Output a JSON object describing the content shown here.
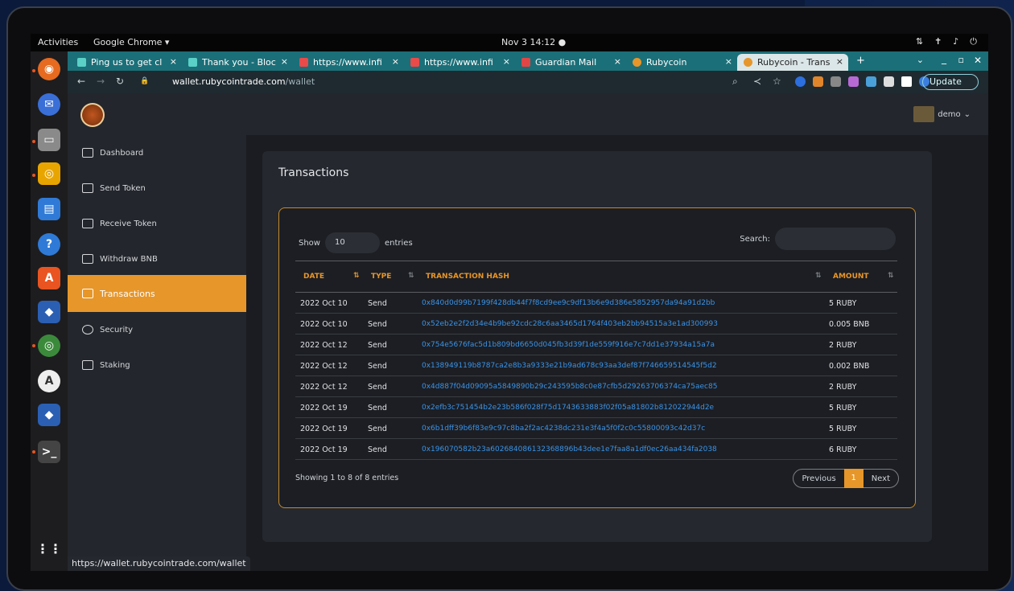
{
  "topbar": {
    "activities": "Activities",
    "app_name": "Google Chrome ▾",
    "clock": "Nov 3  14:12  ●"
  },
  "tabs": [
    {
      "label": "Ping us to get cl",
      "color": "#5ad0c6"
    },
    {
      "label": "Thank you - Bloc",
      "color": "#5ad0c6"
    },
    {
      "label": "https://www.infi",
      "color": "#e94a4a"
    },
    {
      "label": "https://www.infi",
      "color": "#e94a4a"
    },
    {
      "label": "Guardian Mail",
      "color": "#e04646"
    },
    {
      "label": "Rubycoin",
      "color": "#e7962a"
    },
    {
      "label": "Rubycoin - Trans",
      "color": "#e7962a"
    }
  ],
  "address": {
    "host": "wallet.rubycointrade.com",
    "path": "/wallet",
    "update_label": "Update"
  },
  "user": {
    "name": "demo"
  },
  "sidebar": {
    "items": [
      {
        "label": "Dashboard"
      },
      {
        "label": "Send Token"
      },
      {
        "label": "Receive Token"
      },
      {
        "label": "Withdraw BNB"
      },
      {
        "label": "Transactions"
      },
      {
        "label": "Security"
      },
      {
        "label": "Staking"
      }
    ]
  },
  "page": {
    "title": "Transactions",
    "show_label": "Show",
    "show_value": "10",
    "entries_label": "entries",
    "search_label": "Search:",
    "columns": [
      "DATE",
      "TYPE",
      "TRANSACTION HASH",
      "AMOUNT"
    ],
    "rows": [
      {
        "date": "2022 Oct 10",
        "type": "Send",
        "hash": "0x840d0d99b7199f428db44f7f8cd9ee9c9df13b6e9d386e5852957da94a91d2bb",
        "amount": "5 RUBY"
      },
      {
        "date": "2022 Oct 10",
        "type": "Send",
        "hash": "0x52eb2e2f2d34e4b9be92cdc28c6aa3465d1764f403eb2bb94515a3e1ad300993",
        "amount": "0.005 BNB"
      },
      {
        "date": "2022 Oct 12",
        "type": "Send",
        "hash": "0x754e5676fac5d1b809bd6650d045fb3d39f1de559f916e7c7dd1e37934a15a7a",
        "amount": "2 RUBY"
      },
      {
        "date": "2022 Oct 12",
        "type": "Send",
        "hash": "0x138949119b8787ca2e8b3a9333e21b9ad678c93aa3def87f746659514545f5d2",
        "amount": "0.002 BNB"
      },
      {
        "date": "2022 Oct 12",
        "type": "Send",
        "hash": "0x4d887f04d09095a5849890b29c243595b8c0e87cfb5d29263706374ca75aec85",
        "amount": "2 RUBY"
      },
      {
        "date": "2022 Oct 19",
        "type": "Send",
        "hash": "0x2efb3c751454b2e23b586f028f75d1743633883f02f05a81802b812022944d2e",
        "amount": "5 RUBY"
      },
      {
        "date": "2022 Oct 19",
        "type": "Send",
        "hash": "0x6b1dff39b6f83e9c97c8ba2f2ac4238dc231e3f4a5f0f2c0c55800093c42d37c",
        "amount": "5 RUBY"
      },
      {
        "date": "2022 Oct 19",
        "type": "Send",
        "hash": "0x196070582b23a602684086132368896b43dee1e7faa8a1df0ec26aa434fa2038",
        "amount": "6 RUBY"
      }
    ],
    "info": "Showing 1 to 8 of 8 entries",
    "pager": {
      "prev": "Previous",
      "current": "1",
      "next": "Next"
    }
  },
  "status_url": "https://wallet.rubycointrade.com/wallet"
}
